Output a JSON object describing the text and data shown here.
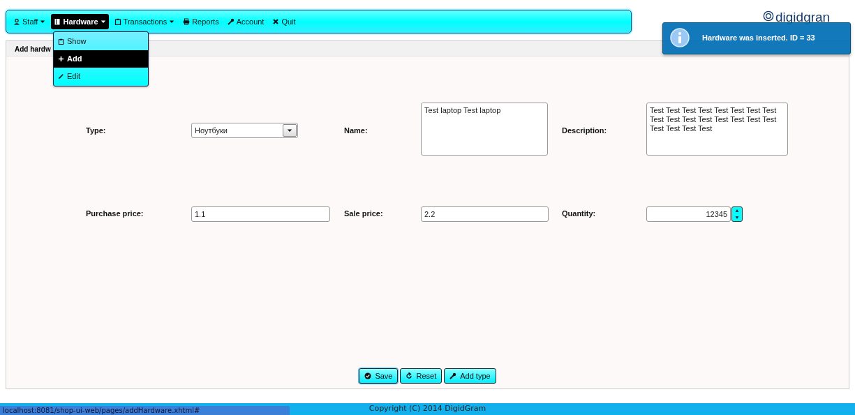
{
  "menu": [
    {
      "label": "Staff",
      "dropdown": true,
      "selected": false
    },
    {
      "label": "Hardware",
      "dropdown": true,
      "selected": true
    },
    {
      "label": "Transactions",
      "dropdown": true,
      "selected": false
    },
    {
      "label": "Reports",
      "dropdown": false,
      "selected": false
    },
    {
      "label": "Account",
      "dropdown": false,
      "selected": false
    },
    {
      "label": "Quit",
      "dropdown": false,
      "selected": false
    }
  ],
  "submenu": [
    {
      "label": "Show",
      "selected": false
    },
    {
      "label": "Add",
      "selected": true
    },
    {
      "label": "Edit",
      "selected": false
    }
  ],
  "logo": "digidgran",
  "notification": "Hardware was inserted. ID = 33",
  "panel_title": "Add hardw",
  "fields": [
    {
      "label": "Type:",
      "kind": "select",
      "value": "Ноутбуки"
    },
    {
      "label": "Name:",
      "kind": "textarea",
      "value": "Test laptop Test laptop"
    },
    {
      "label": "Description:",
      "kind": "textarea",
      "value": "Test Test Test Test Test Test Test Test Test Test Test Test Test Test Test Test Test Test Test Test"
    },
    {
      "label": "Purchase price:",
      "kind": "text",
      "value": "1.1"
    },
    {
      "label": "Sale price:",
      "kind": "text",
      "value": "2.2"
    },
    {
      "label": "Quantity:",
      "kind": "spinner",
      "value": "12345"
    }
  ],
  "buttons": [
    {
      "label": "Save",
      "selected": true
    },
    {
      "label": "Reset",
      "selected": false
    },
    {
      "label": "Add type",
      "selected": false
    }
  ],
  "status_url": "localhost:8081/shop-ui-web/pages/addHardware.xhtml#",
  "copyright": "Copyright (C) 2014 DigidGram"
}
